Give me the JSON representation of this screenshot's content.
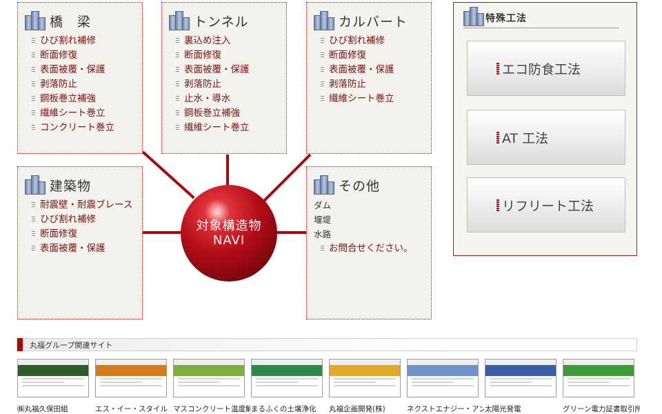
{
  "categories": {
    "bridge": {
      "title": "橋　梁",
      "items": [
        "ひび割れ補修",
        "断面修復",
        "表面被覆・保護",
        "剥落防止",
        "鋼板巻立補強",
        "繊維シート巻立",
        "コンクリート巻立"
      ]
    },
    "tunnel": {
      "title": "トンネル",
      "items": [
        "裏込め注入",
        "断面修復",
        "表面被覆・保護",
        "剥落防止",
        "止水・導水",
        "鋼板巻立補強",
        "繊維シート巻立"
      ]
    },
    "culvert": {
      "title": "カルバート",
      "items": [
        "ひび割れ補修",
        "断面修復",
        "表面被覆・保護",
        "剥落防止",
        "繊維シート巻立"
      ]
    },
    "building": {
      "title": "建築物",
      "items": [
        "耐震壁・耐震ブレース",
        "ひび割れ補修",
        "断面修復",
        "表面被覆・保護"
      ]
    },
    "other": {
      "title": "その他",
      "plain_items": [
        "ダム",
        "堰堤",
        "水路"
      ],
      "link": "お問合せください。"
    }
  },
  "hub": {
    "line1": "対象構造物",
    "line2": "NAVI"
  },
  "special": {
    "title": "特殊工法",
    "buttons": [
      "エコ防食工法",
      "AT 工法",
      "リフリート工法"
    ]
  },
  "group": {
    "title": "丸福グループ関連サイト",
    "sites": [
      {
        "label": "㈱丸福久保田組",
        "color": "#2f5d2a"
      },
      {
        "label": "エス・イー・スタイル",
        "color": "#d77a1e"
      },
      {
        "label": "マスコンクリート温度解析",
        "color": "#7fae3c"
      },
      {
        "label": "まるふくの土壌浄化",
        "color": "#2d8a4a"
      },
      {
        "label": "丸福企画開発(株)",
        "color": "#e3a72c"
      },
      {
        "label": "ネクストエナジー・アンド・",
        "color": "#6f93c9"
      },
      {
        "label": "太陽光発電",
        "color": "#3a5ea8"
      },
      {
        "label": "グリーン電力証書取引所",
        "color": "#3f9a3a"
      }
    ]
  }
}
